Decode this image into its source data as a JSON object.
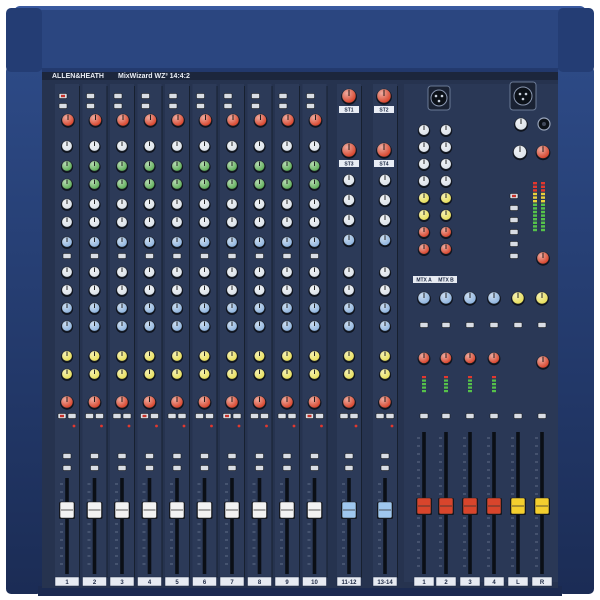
{
  "brand": {
    "name": "ALLEN&HEATH",
    "model": "MixWizard WZ³ 14:4:2"
  },
  "colors": {
    "chassis": "#1f3566",
    "panel": "#26334f",
    "knob_red": "#d8452c",
    "knob_blue": "#8fb4de",
    "knob_green": "#5fae58",
    "knob_yellow": "#e8df5a",
    "knob_white": "#dde3ea",
    "knob_dark": "#2a2f3a",
    "cap_white": "#f2f2f2",
    "cap_blue": "#9fc7ee",
    "cap_red": "#d8452c",
    "cap_yellow": "#f4cf2e"
  },
  "channels": {
    "mono": [
      "1",
      "2",
      "3",
      "4",
      "5",
      "6",
      "7",
      "8",
      "9",
      "10"
    ],
    "stereo": [
      "11-12",
      "13-14"
    ]
  },
  "stereo_returns": {
    "labels": [
      "ST1",
      "ST2",
      "ST3",
      "ST4"
    ]
  },
  "master": {
    "bus_labels": [
      "1",
      "2",
      "3",
      "4",
      "L",
      "R"
    ],
    "matrix_labels": [
      "MTX A",
      "MTX B"
    ]
  }
}
